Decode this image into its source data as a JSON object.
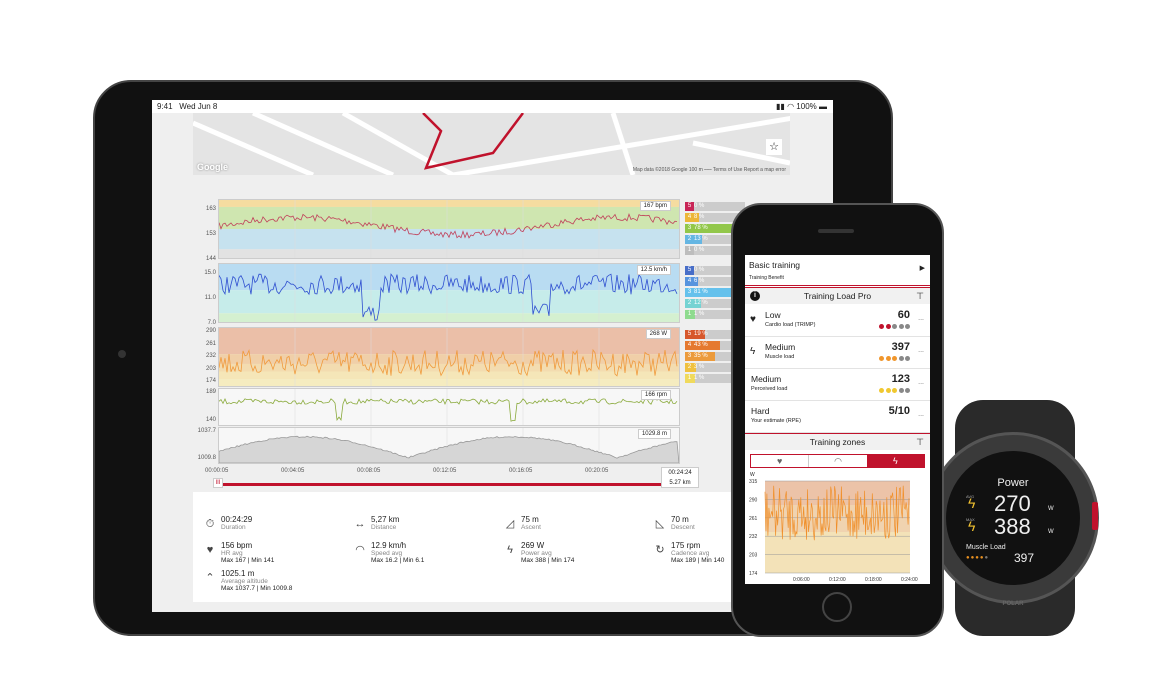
{
  "status_bar": {
    "time": "9:41",
    "date": "Wed Jun 8",
    "battery": "100%"
  },
  "map": {
    "google": "Google",
    "credits": "Map data ©2018 Google   100 m ⎯⎯⎯   Terms of Use   Report a map error",
    "star_icon": "star-icon",
    "route_color": "#c0122c"
  },
  "plots": [
    {
      "name": "heart-rate",
      "ticks": [
        "163",
        "153",
        "144"
      ],
      "readout": "167 bpm",
      "color": "#c0405a",
      "zones": [
        {
          "n": "5",
          "pct": "0 %",
          "color": "#c8134a"
        },
        {
          "n": "4",
          "pct": "8 %",
          "color": "#f0b428"
        },
        {
          "n": "3",
          "pct": "78 %",
          "color": "#8cc63c"
        },
        {
          "n": "2",
          "pct": "13 %",
          "color": "#5ab4e6"
        },
        {
          "n": "1",
          "pct": "0 %",
          "color": "#bbbbbb"
        }
      ]
    },
    {
      "name": "speed",
      "ticks": [
        "15.0",
        "11.0",
        "7.0"
      ],
      "readout": "12.5 km/h",
      "color": "#2f4fd0",
      "zones": [
        {
          "n": "5",
          "pct": "0 %",
          "color": "#3a64c8"
        },
        {
          "n": "4",
          "pct": "6 %",
          "color": "#4a8ee0"
        },
        {
          "n": "3",
          "pct": "81 %",
          "color": "#5ac0f0"
        },
        {
          "n": "2",
          "pct": "12 %",
          "color": "#6cd4d4"
        },
        {
          "n": "1",
          "pct": "1 %",
          "color": "#88dd88"
        }
      ]
    },
    {
      "name": "power",
      "ticks": [
        "290",
        "261",
        "232",
        "203",
        "174"
      ],
      "readout": "268 W",
      "color": "#f09a3c",
      "zones": [
        {
          "n": "5",
          "pct": "19 %",
          "color": "#d84a1a"
        },
        {
          "n": "4",
          "pct": "43 %",
          "color": "#e8701e"
        },
        {
          "n": "3",
          "pct": "35 %",
          "color": "#f0962c"
        },
        {
          "n": "2",
          "pct": "3 %",
          "color": "#f4c030"
        },
        {
          "n": "1",
          "pct": "1 %",
          "color": "#f4dc50"
        }
      ]
    },
    {
      "name": "cadence",
      "ticks": [
        "189",
        "140"
      ],
      "readout": "166 rpm",
      "color": "#8aaa3c"
    },
    {
      "name": "altitude",
      "ticks": [
        "1037.7",
        "1009.8"
      ],
      "readout": "1029.8 m",
      "color": "#999999"
    }
  ],
  "time_axis": [
    "00:00:05",
    "00:04:05",
    "00:08:05",
    "00:12:05",
    "00:16:05",
    "00:20:05"
  ],
  "scrubber": {
    "time": "00:24:24",
    "distance": "5.27 km"
  },
  "stats": [
    {
      "icon": "stopwatch-icon",
      "glyph": "⏱",
      "value": "00:24:29",
      "label": "Duration",
      "minmax": ""
    },
    {
      "icon": "distance-icon",
      "glyph": "↔",
      "value": "5,27 km",
      "label": "Distance",
      "minmax": ""
    },
    {
      "icon": "ascent-icon",
      "glyph": "◿",
      "value": "75 m",
      "label": "Ascent",
      "minmax": ""
    },
    {
      "icon": "descent-icon",
      "glyph": "◺",
      "value": "70 m",
      "label": "Descent",
      "minmax": ""
    },
    {
      "icon": "heart-icon",
      "glyph": "♥",
      "value": "156 bpm",
      "label": "HR avg",
      "minmax": "Max 167  |  Min 141"
    },
    {
      "icon": "speedometer-icon",
      "glyph": "◠",
      "value": "12.9 km/h",
      "label": "Speed avg",
      "minmax": "Max 16.2  |  Min 6.1"
    },
    {
      "icon": "lightning-icon",
      "glyph": "ϟ",
      "value": "269 W",
      "label": "Power avg",
      "minmax": "Max 388  |  Min 174"
    },
    {
      "icon": "cadence-icon",
      "glyph": "↻",
      "value": "175 rpm",
      "label": "Cadence avg",
      "minmax": "Max 189  |  Min 140"
    },
    {
      "icon": "altitude-icon",
      "glyph": "⌃",
      "value": "1025.1 m",
      "label": "Average altitude",
      "minmax": "Max 1037.7  |  Min 1009.8"
    }
  ],
  "phone": {
    "benefit_title": "Basic training",
    "benefit_sub": "Training Benefit",
    "load_header": "Training Load Pro",
    "loads": [
      {
        "icon": "heart-icon",
        "level": "Low",
        "label": "Cardio load (TRIMP)",
        "value": "60",
        "filled": 2,
        "color": "#c0122c"
      },
      {
        "icon": "lightning-icon",
        "level": "Medium",
        "label": "Muscle load",
        "value": "397",
        "filled": 3,
        "color": "#f0962c"
      },
      {
        "icon": "",
        "level": "Medium",
        "label": "Perceived load",
        "value": "123",
        "filled": 3,
        "color": "#f0c830"
      },
      {
        "icon": "",
        "level": "Hard",
        "label": "Your estimate (RPE)",
        "value": "5/10",
        "filled": 0,
        "color": "#888"
      }
    ],
    "more": "...",
    "zones_header": "Training zones",
    "zone_chart": {
      "unit": "W",
      "ticks": [
        "315",
        "290",
        "261",
        "232",
        "203",
        "174"
      ],
      "x_ticks": [
        "0:06:00",
        "0:12:00",
        "0:18:00",
        "0:24:00"
      ]
    }
  },
  "watch": {
    "title": "Power",
    "avg": "270",
    "max": "388",
    "unit": "W",
    "load_label": "Muscle Load",
    "load_value": "397",
    "brand": "POLAR",
    "avg_badge": "AVG",
    "max_badge": "MAX"
  }
}
